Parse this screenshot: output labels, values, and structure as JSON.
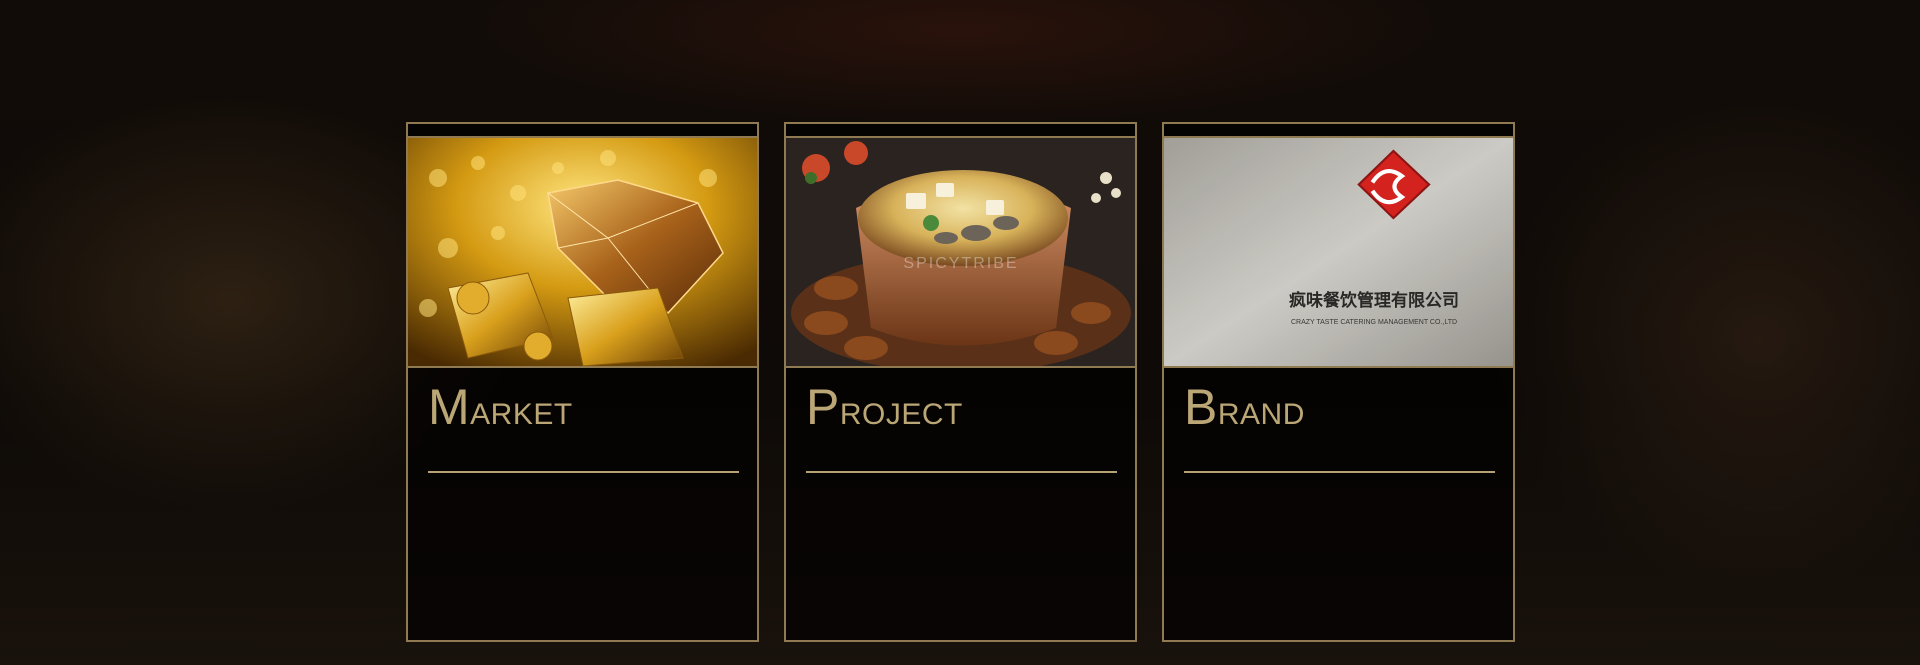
{
  "cards": [
    {
      "id": "market",
      "title_initial": "M",
      "title_rest": "ARKET",
      "image": "gold-diamond-photo"
    },
    {
      "id": "project",
      "title_initial": "P",
      "title_rest": "ROJECT",
      "image": "hotpot-photo",
      "watermark": "SPICYTRIBE"
    },
    {
      "id": "brand",
      "title_initial": "B",
      "title_rest": "RAND",
      "image": "brand-logo-wall-photo",
      "logo_text": "疯味餐饮管理有限公司",
      "logo_subtext": "CRAZY TASTE CATERING MANAGEMENT CO.,LTD"
    }
  ],
  "colors": {
    "gold_border": "#8f7a52",
    "title_gold": "#bba776",
    "logo_red": "#d4221f"
  }
}
